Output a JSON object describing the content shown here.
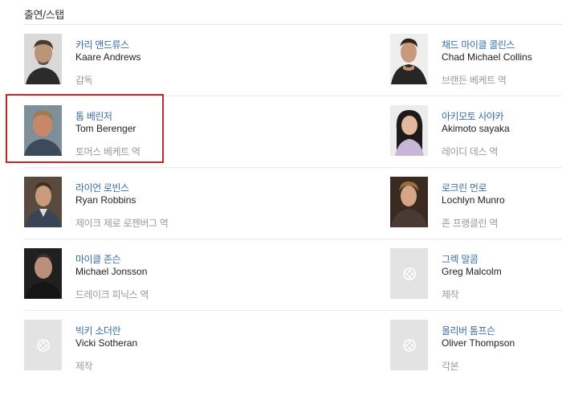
{
  "section": {
    "title": "출연/스탭"
  },
  "colors": {
    "highlight": "#c0282a",
    "link": "#3a6ea5"
  },
  "cast": [
    {
      "left": {
        "kor": "카리 앤드류스",
        "eng": "Kaare Andrews",
        "role": "감독",
        "photo": "photo"
      },
      "right": {
        "kor": "채드 마이클 콜린스",
        "eng": "Chad Michael Collins",
        "role": "브랜든 베케트 역",
        "photo": "photo"
      }
    },
    {
      "left": {
        "kor": "톰 베린저",
        "eng": "Tom Berenger",
        "role": "토머스 베케트 역",
        "photo": "photo"
      },
      "right": {
        "kor": "아키모토 사야카",
        "eng": "Akimoto sayaka",
        "role": "레이디 데스 역",
        "photo": "photo"
      }
    },
    {
      "left": {
        "kor": "라이언 로빈스",
        "eng": "Ryan Robbins",
        "role": "제이크 제로 로젠버그 역",
        "photo": "photo"
      },
      "right": {
        "kor": "로크린 먼로",
        "eng": "Lochlyn Munro",
        "role": "존 프랭클린 역",
        "photo": "photo"
      }
    },
    {
      "left": {
        "kor": "마이클 존슨",
        "eng": "Michael Jonsson",
        "role": "드레이크 피닉스 역",
        "photo": "photo"
      },
      "right": {
        "kor": "그렉 말콤",
        "eng": "Greg Malcolm",
        "role": "제작",
        "photo": "film-reel-icon"
      }
    },
    {
      "left": {
        "kor": "빅키 소더란",
        "eng": "Vicki Sotheran",
        "role": "제작",
        "photo": "film-reel-icon"
      },
      "right": {
        "kor": "올리버 톰프슨",
        "eng": "Oliver Thompson",
        "role": "각본",
        "photo": "film-reel-icon"
      }
    }
  ]
}
